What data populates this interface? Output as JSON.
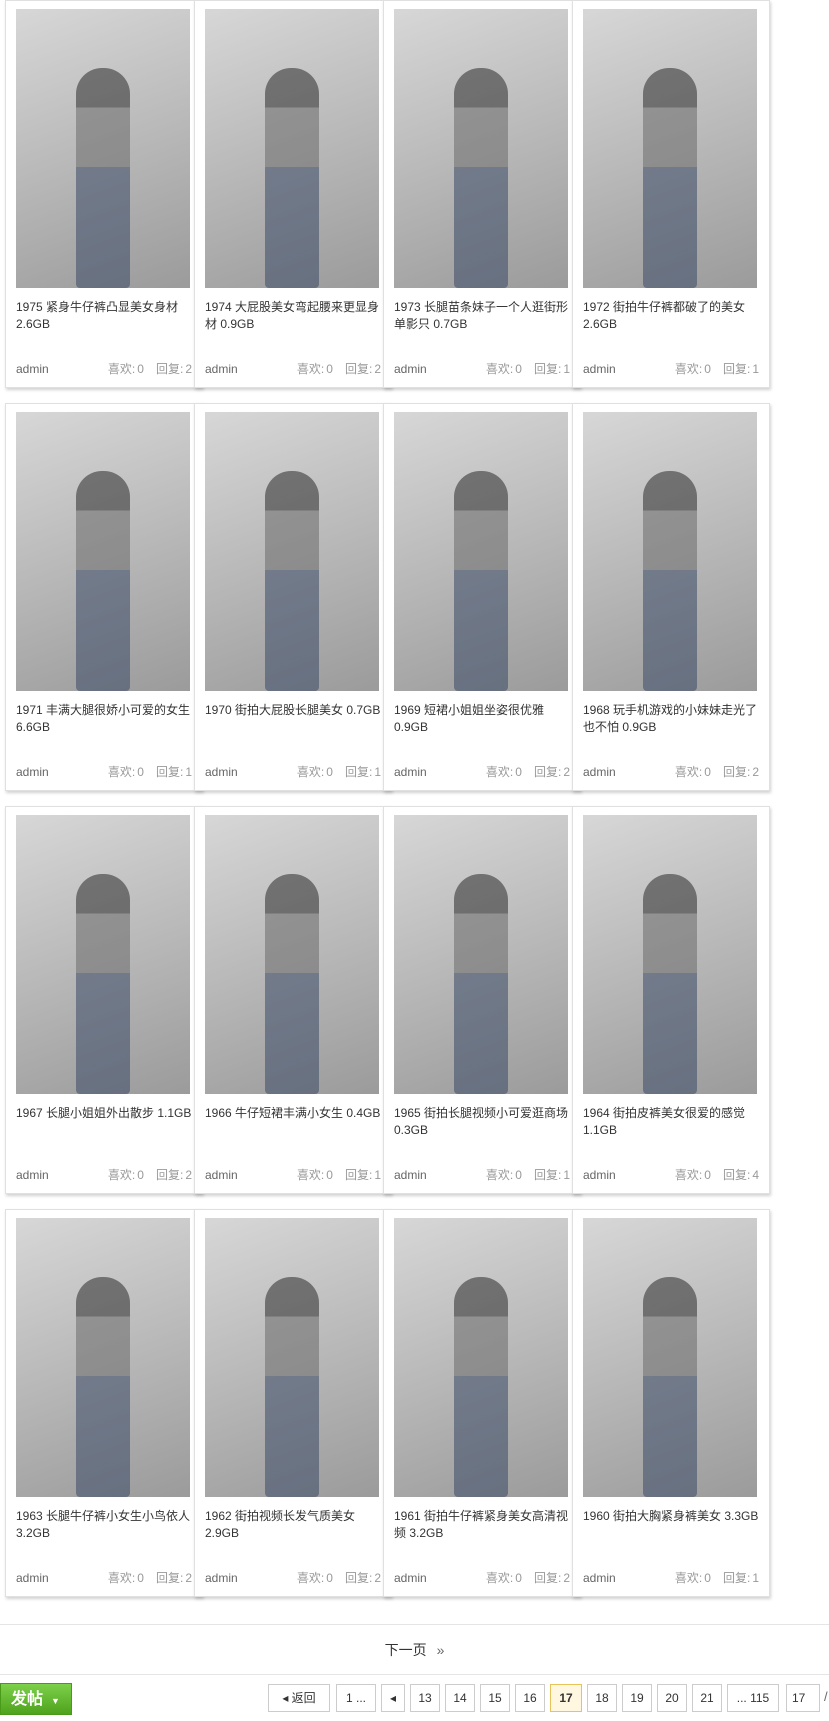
{
  "cards": [
    {
      "title": "1975 紧身牛仔裤凸显美女身材 2.6GB",
      "author": "admin",
      "likes_label": "喜欢:",
      "likes": "0",
      "replies_label": "回复:",
      "replies": "2",
      "thumb_icon": "photo-thumbnail"
    },
    {
      "title": "1974 大屁股美女弯起腰来更显身材 0.9GB",
      "author": "admin",
      "likes_label": "喜欢:",
      "likes": "0",
      "replies_label": "回复:",
      "replies": "2",
      "thumb_icon": "photo-thumbnail"
    },
    {
      "title": "1973 长腿苗条妹子一个人逛街形单影只 0.7GB",
      "author": "admin",
      "likes_label": "喜欢:",
      "likes": "0",
      "replies_label": "回复:",
      "replies": "1",
      "thumb_icon": "photo-thumbnail"
    },
    {
      "title": "1972 街拍牛仔裤都破了的美女 2.6GB",
      "author": "admin",
      "likes_label": "喜欢:",
      "likes": "0",
      "replies_label": "回复:",
      "replies": "1",
      "thumb_icon": "photo-thumbnail"
    },
    {
      "title": "1971 丰满大腿很娇小可爱的女生 6.6GB",
      "author": "admin",
      "likes_label": "喜欢:",
      "likes": "0",
      "replies_label": "回复:",
      "replies": "1",
      "thumb_icon": "photo-thumbnail"
    },
    {
      "title": "1970 街拍大屁股长腿美女 0.7GB",
      "author": "admin",
      "likes_label": "喜欢:",
      "likes": "0",
      "replies_label": "回复:",
      "replies": "1",
      "thumb_icon": "photo-thumbnail"
    },
    {
      "title": "1969 短裙小姐姐坐姿很优雅 0.9GB",
      "author": "admin",
      "likes_label": "喜欢:",
      "likes": "0",
      "replies_label": "回复:",
      "replies": "2",
      "thumb_icon": "photo-thumbnail"
    },
    {
      "title": "1968 玩手机游戏的小妹妹走光了也不怕 0.9GB",
      "author": "admin",
      "likes_label": "喜欢:",
      "likes": "0",
      "replies_label": "回复:",
      "replies": "2",
      "thumb_icon": "photo-thumbnail"
    },
    {
      "title": "1967 长腿小姐姐外出散步 1.1GB",
      "author": "admin",
      "likes_label": "喜欢:",
      "likes": "0",
      "replies_label": "回复:",
      "replies": "2",
      "thumb_icon": "photo-thumbnail"
    },
    {
      "title": "1966 牛仔短裙丰满小女生 0.4GB",
      "author": "admin",
      "likes_label": "喜欢:",
      "likes": "0",
      "replies_label": "回复:",
      "replies": "1",
      "thumb_icon": "photo-thumbnail"
    },
    {
      "title": "1965 街拍长腿视频小可爱逛商场 0.3GB",
      "author": "admin",
      "likes_label": "喜欢:",
      "likes": "0",
      "replies_label": "回复:",
      "replies": "1",
      "thumb_icon": "photo-thumbnail"
    },
    {
      "title": "1964 街拍皮裤美女很爱的感觉 1.1GB",
      "author": "admin",
      "likes_label": "喜欢:",
      "likes": "0",
      "replies_label": "回复:",
      "replies": "4",
      "thumb_icon": "photo-thumbnail"
    },
    {
      "title": "1963 长腿牛仔裤小女生小鸟依人 3.2GB",
      "author": "admin",
      "likes_label": "喜欢:",
      "likes": "0",
      "replies_label": "回复:",
      "replies": "2",
      "thumb_icon": "photo-thumbnail"
    },
    {
      "title": "1962 街拍视频长发气质美女 2.9GB",
      "author": "admin",
      "likes_label": "喜欢:",
      "likes": "0",
      "replies_label": "回复:",
      "replies": "2",
      "thumb_icon": "photo-thumbnail"
    },
    {
      "title": "1961 街拍牛仔裤紧身美女高清视频 3.2GB",
      "author": "admin",
      "likes_label": "喜欢:",
      "likes": "0",
      "replies_label": "回复:",
      "replies": "2",
      "thumb_icon": "photo-thumbnail"
    },
    {
      "title": "1960 街拍大胸紧身裤美女 3.3GB",
      "author": "admin",
      "likes_label": "喜欢:",
      "likes": "0",
      "replies_label": "回复:",
      "replies": "1",
      "thumb_icon": "photo-thumbnail"
    }
  ],
  "next_page": {
    "label": "下一页",
    "arrow": "»"
  },
  "post_button": {
    "label": "发帖",
    "caret": "▼"
  },
  "pager": {
    "back": "◂ 返回",
    "first": "1 ...",
    "prev": "◂",
    "pages": [
      "13",
      "14",
      "15",
      "16",
      "17",
      "18",
      "19",
      "20",
      "21"
    ],
    "current": "17",
    "last": "... 115",
    "input_value": "17",
    "slash": "/"
  },
  "colors": {
    "accent": "#4fa21c",
    "current_page_bg": "#fff7e0"
  }
}
